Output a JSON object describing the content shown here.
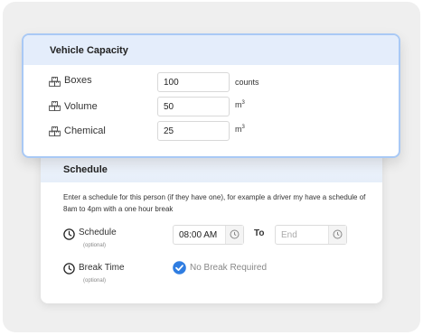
{
  "capacity": {
    "title": "Vehicle Capacity",
    "rows": [
      {
        "label": "Boxes",
        "value": "100",
        "unit": "counts",
        "unit_sup": "",
        "icon": "boxes-icon"
      },
      {
        "label": "Volume",
        "value": "50",
        "unit": "m",
        "unit_sup": "3",
        "icon": "boxes-icon"
      },
      {
        "label": "Chemical",
        "value": "25",
        "unit": "m",
        "unit_sup": "3",
        "icon": "boxes-icon"
      }
    ]
  },
  "schedule": {
    "title": "Schedule",
    "description": "Enter a schedule for this person (if they have one), for example a driver my have a schedule of 8am to 4pm with a one hour break",
    "schedule_label": "Schedule",
    "schedule_sub": "(optional)",
    "start_value": "08:00 AM",
    "to_label": "To",
    "end_placeholder": "End",
    "break_label": "Break Time",
    "break_sub": "(optional)",
    "no_break_label": "No Break Required",
    "no_break_checked": true
  },
  "colors": {
    "accent": "#2f7de1",
    "header_bg": "#e4edfb",
    "card_border": "#a9c9f5"
  }
}
